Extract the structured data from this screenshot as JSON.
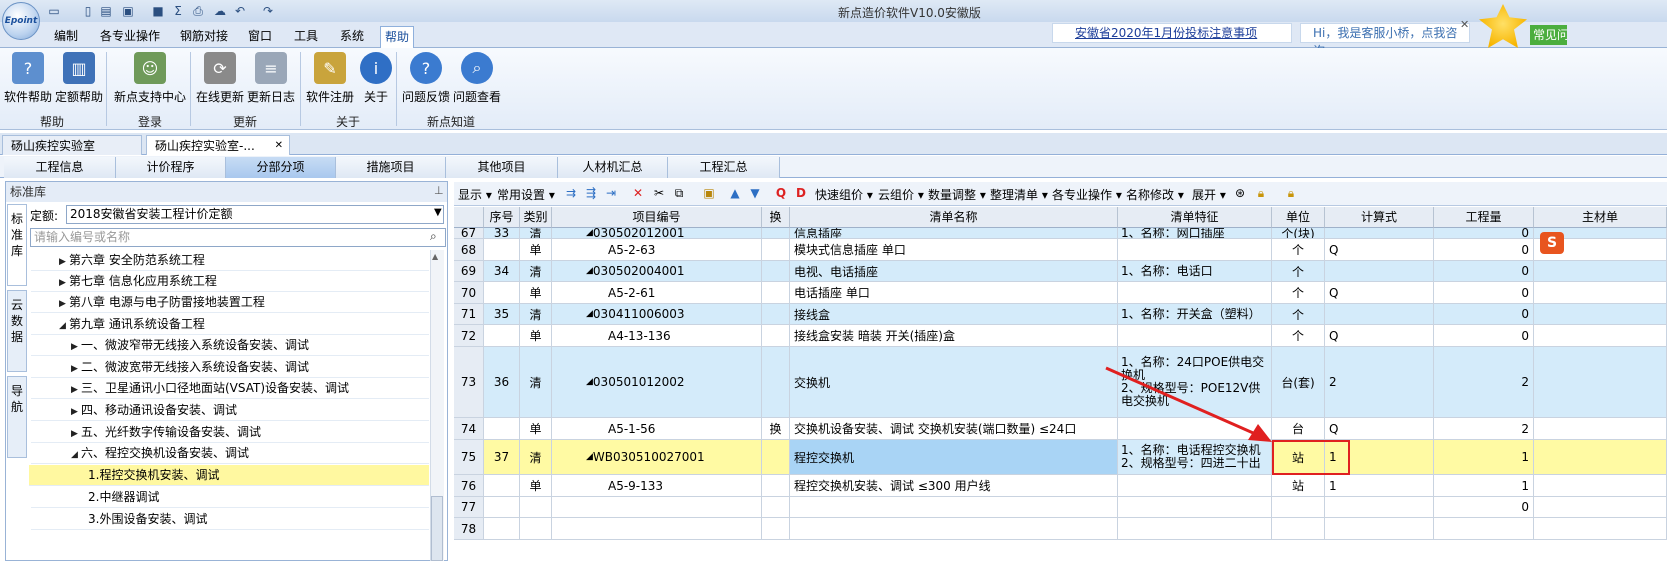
{
  "app": {
    "title": "新点造价软件V10.0安徽版",
    "logo": "Epoint"
  },
  "menu": [
    "编制",
    "各专业操作",
    "钢筋对接",
    "窗口",
    "工具",
    "系统",
    "帮助"
  ],
  "notice": "安徽省2020年1月份投标注意事项",
  "chat": "Hi，我是客服小桥，点我咨询",
  "faq": "常见问题",
  "ribbon": {
    "buttons": [
      "软件帮助",
      "定额帮助",
      "新点支持中心",
      "在线更新",
      "更新日志",
      "软件注册",
      "关于",
      "问题反馈",
      "问题查看"
    ],
    "groups": [
      "帮助",
      "登录",
      "更新",
      "关于",
      "新点知道"
    ]
  },
  "doc_tabs": [
    "砀山疾控实验室",
    "砀山疾控实验室-..."
  ],
  "project_tabs": [
    "工程信息",
    "计价程序",
    "分部分项",
    "措施项目",
    "其他项目",
    "人材机汇总",
    "工程汇总"
  ],
  "left": {
    "title": "标准库",
    "vtabs": [
      "标准库",
      "云数据",
      "导航"
    ],
    "quota_label": "定额:",
    "quota_value": "2018安徽省安装工程计价定额",
    "search_placeholder": "请输入编号或名称",
    "tree": [
      "第六章 安全防范系统工程",
      "第七章 信息化应用系统工程",
      "第八章 电源与电子防雷接地装置工程",
      "第九章 通讯系统设备工程",
      "一、微波窄带无线接入系统设备安装、调试",
      "二、微波宽带无线接入系统设备安装、调试",
      "三、卫星通讯小口径地面站(VSAT)设备安装、调试",
      "四、移动通讯设备安装、调试",
      "五、光纤数字传输设备安装、调试",
      "六、程控交换机设备安装、调试",
      "1.程控交换机安装、调试",
      "2.中继器调试",
      "3.外围设备安装、调试"
    ]
  },
  "toolbar": [
    "显示",
    "常用设置",
    "快速组价",
    "云组价",
    "数量调整",
    "整理清单",
    "各专业操作",
    "名称修改",
    "展开"
  ],
  "grid": {
    "headers": [
      "序号",
      "类别",
      "项目编号",
      "换",
      "清单名称",
      "清单特征",
      "单位",
      "计算式",
      "工程量",
      "主材单"
    ],
    "rows": [
      {
        "n": "67",
        "s": "33",
        "t": "清",
        "code": "030502012001",
        "h": "",
        "name": "信息插座",
        "feat": "1、名称：网口插座",
        "unit": "个(块)",
        "calc": "",
        "qty": "0"
      },
      {
        "n": "68",
        "s": "",
        "t": "单",
        "code": "A5-2-63",
        "h": "",
        "name": "模块式信息插座 单口",
        "feat": "",
        "unit": "个",
        "calc": "Q",
        "qty": "0"
      },
      {
        "n": "69",
        "s": "34",
        "t": "清",
        "code": "030502004001",
        "h": "",
        "name": "电视、电话插座",
        "feat": "1、名称：电话口",
        "unit": "个",
        "calc": "",
        "qty": "0"
      },
      {
        "n": "70",
        "s": "",
        "t": "单",
        "code": "A5-2-61",
        "h": "",
        "name": "电话插座 单口",
        "feat": "",
        "unit": "个",
        "calc": "Q",
        "qty": "0"
      },
      {
        "n": "71",
        "s": "35",
        "t": "清",
        "code": "030411006003",
        "h": "",
        "name": "接线盒",
        "feat": "1、名称：开关盒（塑料）",
        "unit": "个",
        "calc": "",
        "qty": "0"
      },
      {
        "n": "72",
        "s": "",
        "t": "单",
        "code": "A4-13-136",
        "h": "",
        "name": "接线盒安装 暗装 开关(插座)盒",
        "feat": "",
        "unit": "个",
        "calc": "Q",
        "qty": "0"
      },
      {
        "n": "73",
        "s": "36",
        "t": "清",
        "code": "030501012002",
        "h": "",
        "name": "交换机",
        "feat": "1、名称：24口POE供电交换机\n2、规格型号：POE12V供电交换机",
        "unit": "台(套)",
        "calc": "2",
        "qty": "2"
      },
      {
        "n": "74",
        "s": "",
        "t": "单",
        "code": "A5-1-56",
        "h": "换",
        "name": "交换机设备安装、调试 交换机安装(端口数量) ≤24口",
        "feat": "",
        "unit": "台",
        "calc": "Q",
        "qty": "2"
      },
      {
        "n": "75",
        "s": "37",
        "t": "清",
        "code": "WB030510027001",
        "h": "",
        "name": "程控交换机",
        "feat": "1、名称：电话程控交换机\n2、规格型号：四进二十出",
        "unit": "站",
        "calc": "1",
        "qty": "1"
      },
      {
        "n": "76",
        "s": "",
        "t": "单",
        "code": "A5-9-133",
        "h": "",
        "name": "程控交换机安装、调试 ≤300 用户线",
        "feat": "",
        "unit": "站",
        "calc": "1",
        "qty": "1"
      },
      {
        "n": "77",
        "s": "",
        "t": "",
        "code": "",
        "h": "",
        "name": "",
        "feat": "",
        "unit": "",
        "calc": "",
        "qty": "0"
      },
      {
        "n": "78",
        "s": "",
        "t": "",
        "code": "",
        "h": "",
        "name": "",
        "feat": "",
        "unit": "",
        "calc": "",
        "qty": ""
      }
    ]
  },
  "colors": {
    "accent": "#2f6fc5",
    "highlight_row": "#fffaa3",
    "clear_row": "#d4ebfa",
    "selected_cell": "#a9d4f5",
    "marker": "#e02020"
  }
}
